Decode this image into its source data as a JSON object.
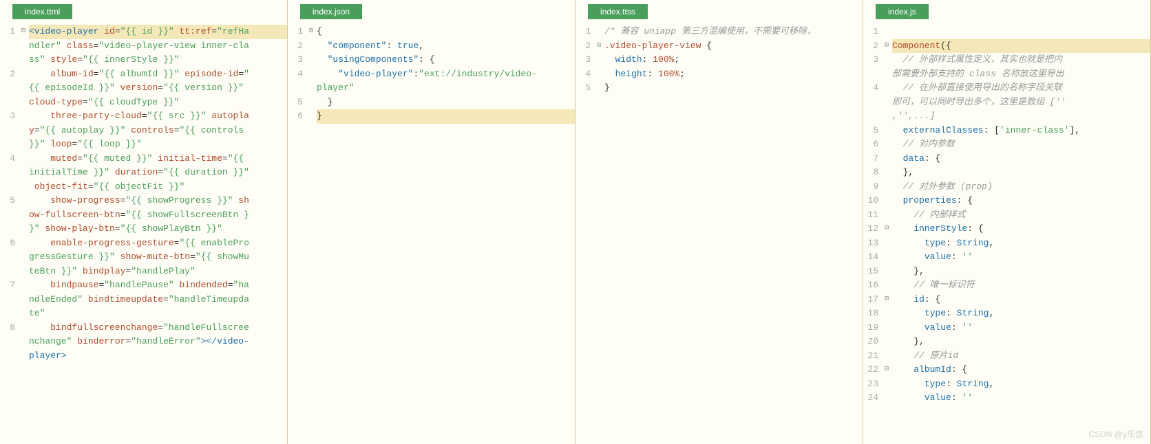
{
  "panes": [
    {
      "tab": "index.ttml",
      "gutter": [
        "1",
        "",
        "",
        "2",
        "",
        "",
        "3",
        "",
        "",
        "4",
        "",
        "",
        "5",
        "",
        "",
        "6",
        "",
        "",
        "7",
        "",
        "",
        "8",
        "",
        "",
        ""
      ],
      "fold": [
        "⊟",
        "",
        "",
        "",
        "",
        "",
        "",
        "",
        "",
        "",
        "",
        "",
        "",
        "",
        "",
        "",
        "",
        "",
        "",
        "",
        "",
        "",
        "",
        "",
        ""
      ],
      "lines": [
        {
          "html": "<span class='tag'>&lt;video-player</span> <span class='attr'>id</span>=<span class='val'>\"{{ id }}\"</span> <span class='attr'>tt:ref</span>=<span class='val'>\"refHa</span>",
          "hl": true
        },
        {
          "html": "<span class='val'>ndler\"</span> <span class='attr'>class</span>=<span class='val'>\"video-player-view inner-cla</span>"
        },
        {
          "html": "<span class='val'>ss\"</span> <span class='attr'>style</span>=<span class='val'>\"{{ innerStyle }}\"</span>"
        },
        {
          "html": "    <span class='attr'>album-id</span>=<span class='val'>\"{{ albumId }}\"</span> <span class='attr'>episode-id</span>=<span class='val'>\"</span>"
        },
        {
          "html": "<span class='val'>{{ episodeId }}\"</span> <span class='attr'>version</span>=<span class='val'>\"{{ version }}\"</span> "
        },
        {
          "html": "<span class='attr'>cloud-type</span>=<span class='val'>\"{{ cloudType }}\"</span>"
        },
        {
          "html": "    <span class='attr'>three-party-cloud</span>=<span class='val'>\"{{ src }}\"</span> <span class='attr'>autopla</span>"
        },
        {
          "html": "<span class='attr'>y</span>=<span class='val'>\"{{ autoplay }}\"</span> <span class='attr'>controls</span>=<span class='val'>\"{{ controls </span>"
        },
        {
          "html": "<span class='val'>}}\"</span> <span class='attr'>loop</span>=<span class='val'>\"{{ loop }}\"</span>"
        },
        {
          "html": "    <span class='attr'>muted</span>=<span class='val'>\"{{ muted }}\"</span> <span class='attr'>initial-time</span>=<span class='val'>\"{{ </span>"
        },
        {
          "html": "<span class='val'>initialTime }}\"</span> <span class='attr'>duration</span>=<span class='val'>\"{{ duration }}\"</span>"
        },
        {
          "html": " <span class='attr'>object-fit</span>=<span class='val'>\"{{ objectFit }}\"</span>"
        },
        {
          "html": "    <span class='attr'>show-progress</span>=<span class='val'>\"{{ showProgress }}\"</span> <span class='attr'>sh</span>"
        },
        {
          "html": "<span class='attr'>ow-fullscreen-btn</span>=<span class='val'>\"{{ showFullscreenBtn }</span>"
        },
        {
          "html": "<span class='val'>}\"</span> <span class='attr'>show-play-btn</span>=<span class='val'>\"{{ showPlayBtn }}\"</span>"
        },
        {
          "html": "    <span class='attr'>enable-progress-gesture</span>=<span class='val'>\"{{ enablePro</span>"
        },
        {
          "html": "<span class='val'>gressGesture }}\"</span> <span class='attr'>show-mute-btn</span>=<span class='val'>\"{{ showMu</span>"
        },
        {
          "html": "<span class='val'>teBtn }}\"</span> <span class='attr'>bindplay</span>=<span class='val'>\"handlePlay\"</span>"
        },
        {
          "html": "    <span class='attr'>bindpause</span>=<span class='val'>\"handlePause\"</span> <span class='attr'>bindended</span>=<span class='val'>\"ha</span>"
        },
        {
          "html": "<span class='val'>ndleEnded\"</span> <span class='attr'>bindtimeupdate</span>=<span class='val'>\"handleTimeupda</span>"
        },
        {
          "html": "<span class='val'>te\"</span>"
        },
        {
          "html": "    <span class='attr'>bindfullscreenchange</span>=<span class='val'>\"handleFullscree</span>"
        },
        {
          "html": "<span class='val'>nchange\"</span> <span class='attr'>binderror</span>=<span class='val'>\"handleError\"</span><span class='tag'>&gt;&lt;/video-</span>"
        },
        {
          "html": "<span class='tag'>player&gt;</span>"
        }
      ]
    },
    {
      "tab": "index.json",
      "gutter": [
        "1",
        "2",
        "3",
        "4",
        "",
        "5",
        "6"
      ],
      "fold": [
        "⊟",
        "",
        "",
        "",
        "",
        "",
        ""
      ],
      "lines": [
        {
          "html": "<span class='punct'>{</span>"
        },
        {
          "html": "  <span class='key'>\"component\"</span>: <span class='kw'>true</span>,"
        },
        {
          "html": "  <span class='key'>\"usingComponents\"</span>: {"
        },
        {
          "html": "    <span class='key'>\"video-player\"</span>:<span class='str'>\"ext://industry/video-</span>"
        },
        {
          "html": "<span class='str'>player\"</span>"
        },
        {
          "html": "  }"
        },
        {
          "html": "<span class='punct'>}</span>",
          "hl": true
        }
      ]
    },
    {
      "tab": "index.ttss",
      "gutter": [
        "1",
        "2",
        "3",
        "4",
        "5"
      ],
      "fold": [
        "",
        "⊟",
        "",
        "",
        ""
      ],
      "lines": [
        {
          "html": "<span class='com'>/* 兼容 uniapp 第三方混编使用，不需要可移除，</span>"
        },
        {
          "html": "<span class='sel'>.video-player-view</span> {"
        },
        {
          "html": "  <span class='prop'>width</span>: <span class='num'>100%</span>;"
        },
        {
          "html": "  <span class='prop'>height</span>: <span class='num'>100%</span>;"
        },
        {
          "html": "}"
        }
      ]
    },
    {
      "tab": "index.js",
      "gutter": [
        "1",
        "2",
        "3",
        "",
        "4",
        "",
        "",
        "5",
        "6",
        "7",
        "8",
        "9",
        "10",
        "11",
        "12",
        "13",
        "14",
        "15",
        "16",
        "17",
        "18",
        "19",
        "20",
        "21",
        "22",
        "23",
        "24"
      ],
      "fold": [
        "",
        "⊟",
        "",
        "",
        "",
        "",
        "",
        "",
        "",
        "",
        "",
        "",
        "",
        "",
        "⊟",
        "",
        "",
        "",
        "",
        "⊟",
        "",
        "",
        "",
        "",
        "⊟",
        "",
        ""
      ],
      "lines": [
        {
          "html": ""
        },
        {
          "html": "<span class='fn'>Component</span>({",
          "hl": true
        },
        {
          "html": "  <span class='com'>// 外部样式属性定义，其实也就是把内</span>"
        },
        {
          "html": "<span class='com'>部需要外部支持的 class 名称放这里导出</span>"
        },
        {
          "html": "  <span class='com'>// 在外部直接使用导出的名称字段关联</span>"
        },
        {
          "html": "<span class='com'>即可，可以同时导出多个，这里是数组 [''</span>"
        },
        {
          "html": "<span class='com'>,'',...]</span>"
        },
        {
          "html": "  <span class='prop'>externalClasses</span>: [<span class='str'>'inner-class'</span>],"
        },
        {
          "html": "  <span class='com'>// 对内参数</span>"
        },
        {
          "html": "  <span class='prop'>data</span>: {"
        },
        {
          "html": "  },"
        },
        {
          "html": "  <span class='com'>// 对外参数 (prop)</span>"
        },
        {
          "html": "  <span class='prop'>properties</span>: {"
        },
        {
          "html": "    <span class='com'>// 内部样式</span>"
        },
        {
          "html": "    <span class='prop'>innerStyle</span>: {"
        },
        {
          "html": "      <span class='prop'>type</span>: <span class='kw'>String</span>,"
        },
        {
          "html": "      <span class='prop'>value</span>: <span class='str'>''</span>"
        },
        {
          "html": "    },"
        },
        {
          "html": "    <span class='com'>// 唯一标识符</span>"
        },
        {
          "html": "    <span class='prop'>id</span>: {"
        },
        {
          "html": "      <span class='prop'>type</span>: <span class='kw'>String</span>,"
        },
        {
          "html": "      <span class='prop'>value</span>: <span class='str'>''</span>"
        },
        {
          "html": "    },"
        },
        {
          "html": "    <span class='com'>// 原片id</span>"
        },
        {
          "html": "    <span class='prop'>albumId</span>: {"
        },
        {
          "html": "      <span class='prop'>type</span>: <span class='kw'>String</span>,"
        },
        {
          "html": "      <span class='prop'>value</span>: <span class='str'>''</span>"
        }
      ]
    }
  ],
  "watermark": "CSDN @y乐悠"
}
